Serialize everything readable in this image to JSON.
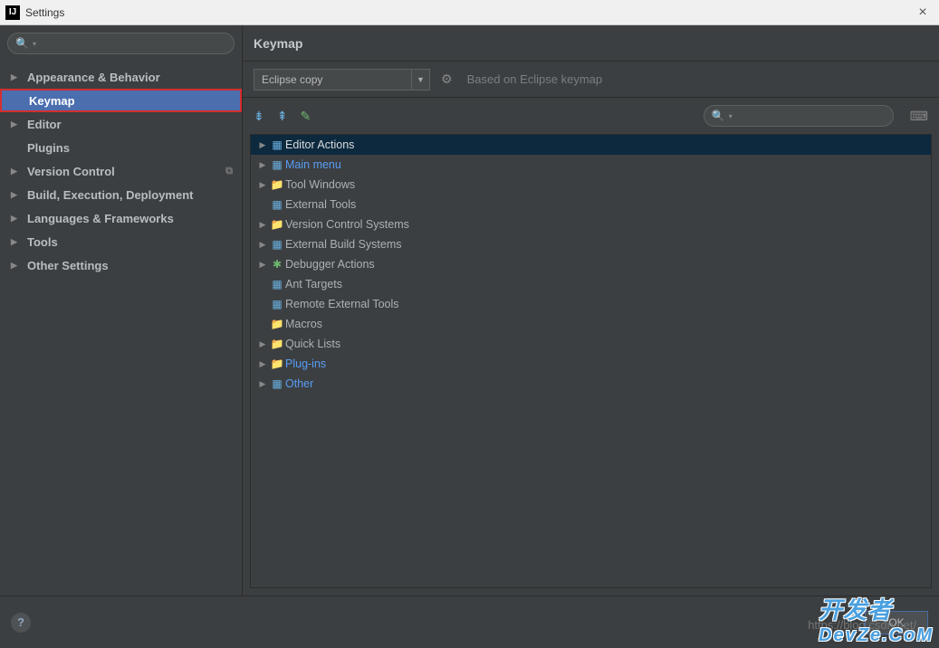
{
  "window": {
    "title": "Settings",
    "app_icon_text": "IJ"
  },
  "sidebar": {
    "items": [
      {
        "label": "Appearance & Behavior",
        "expandable": true
      },
      {
        "label": "Keymap",
        "expandable": false,
        "selected": true,
        "highlighted": true
      },
      {
        "label": "Editor",
        "expandable": true
      },
      {
        "label": "Plugins",
        "expandable": false
      },
      {
        "label": "Version Control",
        "expandable": true,
        "trailing": "⧉"
      },
      {
        "label": "Build, Execution, Deployment",
        "expandable": true
      },
      {
        "label": "Languages & Frameworks",
        "expandable": true
      },
      {
        "label": "Tools",
        "expandable": true
      },
      {
        "label": "Other Settings",
        "expandable": true
      }
    ]
  },
  "main": {
    "title": "Keymap",
    "combo_value": "Eclipse copy",
    "based_on": "Based on Eclipse keymap",
    "tree": [
      {
        "label": "Editor Actions",
        "expandable": true,
        "selected": true,
        "icon": "special"
      },
      {
        "label": "Main menu",
        "expandable": true,
        "icon": "special",
        "link": true
      },
      {
        "label": "Tool Windows",
        "expandable": true,
        "icon": "folder"
      },
      {
        "label": "External Tools",
        "expandable": false,
        "icon": "special"
      },
      {
        "label": "Version Control Systems",
        "expandable": true,
        "icon": "folder"
      },
      {
        "label": "External Build Systems",
        "expandable": true,
        "icon": "special"
      },
      {
        "label": "Debugger Actions",
        "expandable": true,
        "icon": "bug"
      },
      {
        "label": "Ant Targets",
        "expandable": false,
        "icon": "special"
      },
      {
        "label": "Remote External Tools",
        "expandable": false,
        "icon": "special"
      },
      {
        "label": "Macros",
        "expandable": false,
        "icon": "folder"
      },
      {
        "label": "Quick Lists",
        "expandable": true,
        "icon": "folder"
      },
      {
        "label": "Plug-ins",
        "expandable": true,
        "icon": "folder",
        "link": true
      },
      {
        "label": "Other",
        "expandable": true,
        "icon": "special",
        "link": true
      }
    ]
  },
  "footer": {
    "ok": "OK",
    "url": "https://blog.csdn.net/..."
  },
  "watermark": {
    "line1": "开发者",
    "line2": "DevZe.CoM"
  }
}
